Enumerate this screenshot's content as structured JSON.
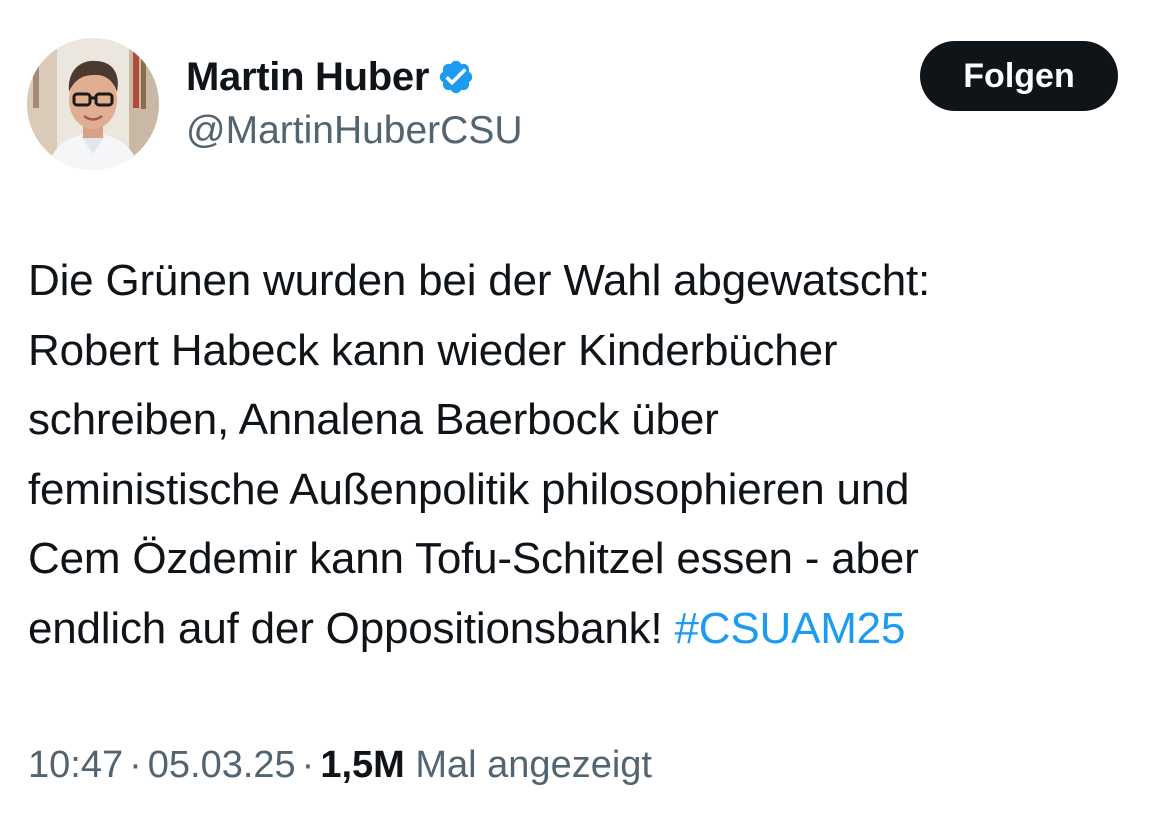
{
  "author": {
    "display_name": "Martin Huber",
    "handle": "@MartinHuberCSU",
    "verified": true,
    "avatar_icon": "profile-photo"
  },
  "follow_button": {
    "label": "Folgen"
  },
  "tweet": {
    "lines": [
      "Die Grünen wurden bei der Wahl abgewatscht:",
      "Robert Habeck kann wieder Kinderbücher",
      "schreiben, Annalena Baerbock über",
      "feministische Außenpolitik philosophieren und",
      "Cem Özdemir kann Tofu-Schitzel essen - aber",
      "endlich auf der Oppositionsbank!"
    ],
    "hashtag": "#CSUAM25"
  },
  "meta": {
    "time": "10:47",
    "separator": "·",
    "date": "05.03.25",
    "views_count": "1,5M",
    "views_label": "Mal angezeigt"
  },
  "colors": {
    "text": "#0f1419",
    "secondary": "#536471",
    "link": "#1d9bf0",
    "verified": "#1d9bf0",
    "button_bg": "#0f1419"
  }
}
